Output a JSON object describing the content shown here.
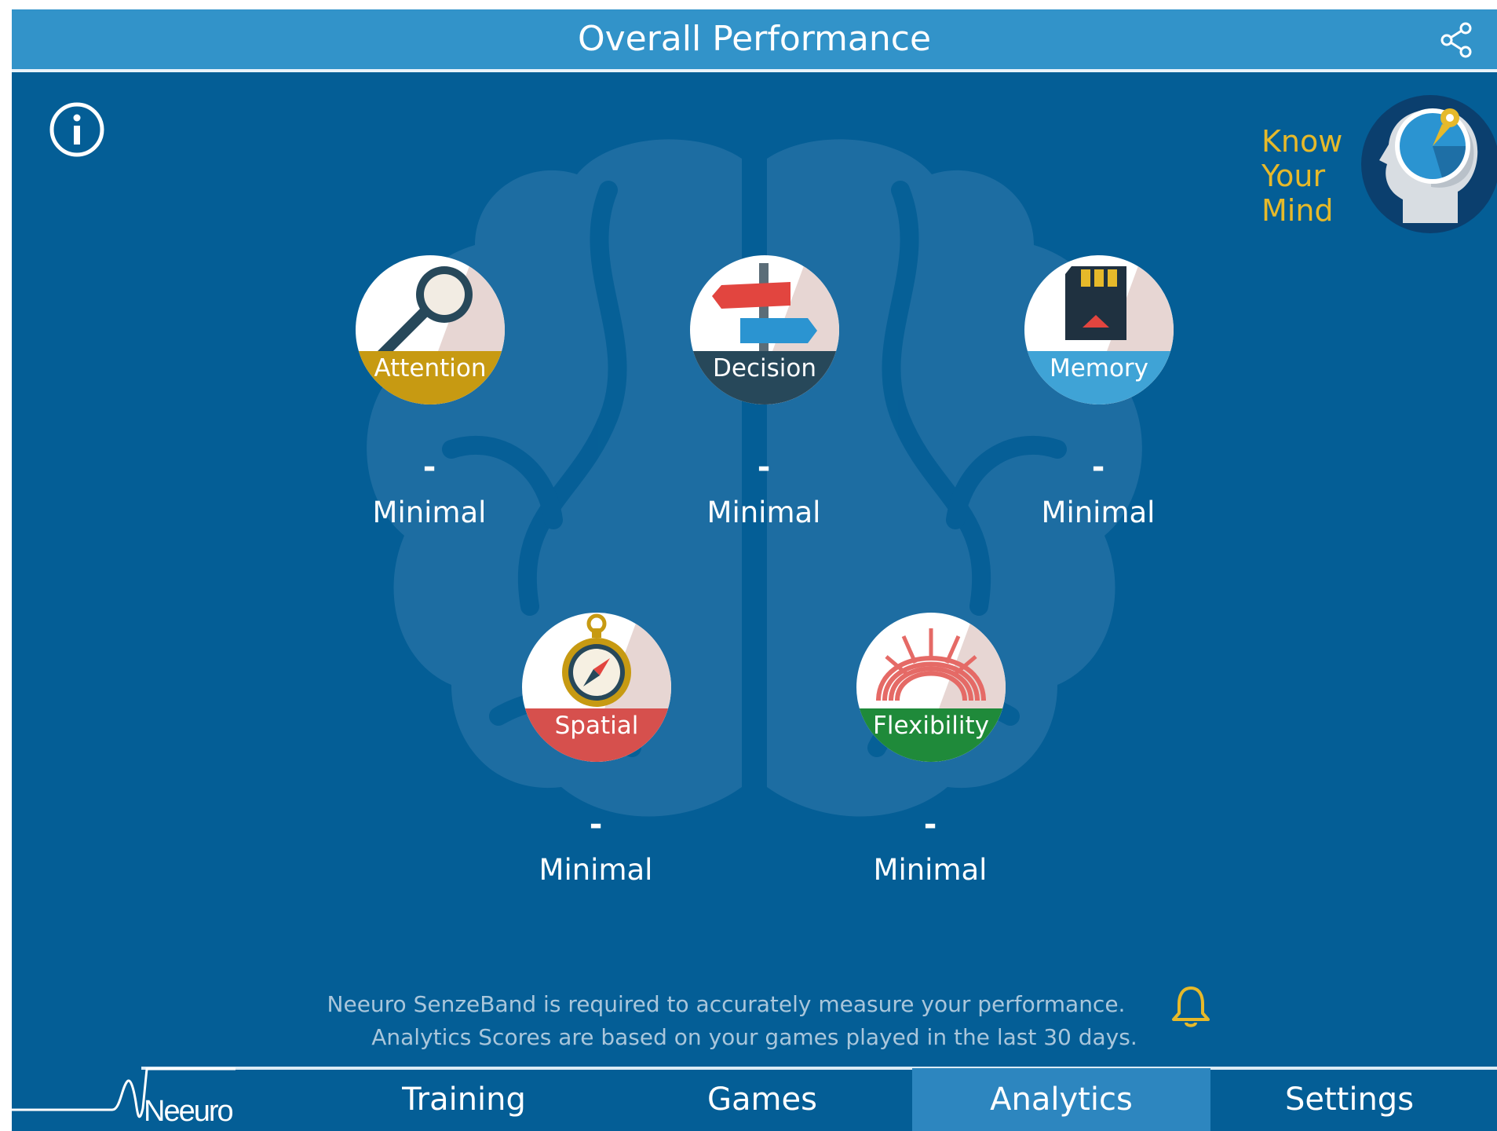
{
  "header": {
    "title": "Overall Performance"
  },
  "know_your_mind": {
    "lines": [
      "Know",
      "Your",
      "Mind"
    ]
  },
  "skills": [
    {
      "label": "Attention",
      "score": "-",
      "level": "Minimal",
      "color": "#c79a12"
    },
    {
      "label": "Decision",
      "score": "-",
      "level": "Minimal",
      "color": "#27485a"
    },
    {
      "label": "Memory",
      "score": "-",
      "level": "Minimal",
      "color": "#3fa3d6"
    },
    {
      "label": "Spatial",
      "score": "-",
      "level": "Minimal",
      "color": "#d6504d"
    },
    {
      "label": "Flexibility",
      "score": "-",
      "level": "Minimal",
      "color": "#1f8a3a"
    }
  ],
  "note": {
    "line1": "Neeuro SenzeBand is required to accurately measure your performance.",
    "line2": "Analytics Scores are based on your games played in the last 30 days."
  },
  "nav": {
    "logo": "Neeuro",
    "tabs": [
      {
        "label": "Training",
        "active": false
      },
      {
        "label": "Games",
        "active": false
      },
      {
        "label": "Analytics",
        "active": true
      },
      {
        "label": "Settings",
        "active": false
      }
    ]
  },
  "colors": {
    "background": "#045e96",
    "header": "#3293c9",
    "accent_yellow": "#e6b92a",
    "active_tab": "#2d86bf"
  },
  "icons": [
    "share-icon",
    "info-icon",
    "head-compass-icon",
    "magnifier-icon",
    "signpost-icon",
    "memory-card-icon",
    "compass-icon",
    "spring-icon",
    "bell-icon"
  ]
}
